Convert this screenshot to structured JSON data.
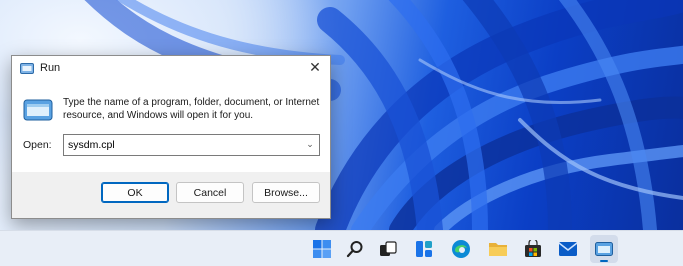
{
  "run_dialog": {
    "title": "Run",
    "close_glyph": "✕",
    "description": "Type the name of a program, folder, document, or Internet resource, and Windows will open it for you.",
    "open_label": "Open:",
    "open_value": "sysdm.cpl",
    "ok_label": "OK",
    "cancel_label": "Cancel",
    "browse_label": "Browse..."
  },
  "taskbar": {
    "icons": [
      "start-icon",
      "search-icon",
      "task-view-icon",
      "widgets-icon",
      "edge-icon",
      "file-explorer-icon",
      "store-icon",
      "mail-icon",
      "run-icon"
    ],
    "active_icon": "run-icon"
  },
  "colors": {
    "accent": "#0067c0",
    "wallpaper_blue": "#1e5fe0"
  }
}
